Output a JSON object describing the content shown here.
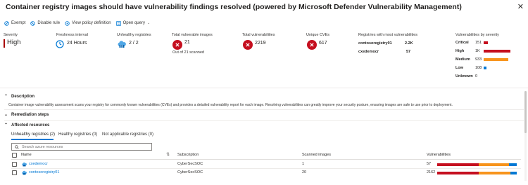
{
  "header": {
    "title": "Container registry images should have vulnerability findings resolved (powered by Microsoft Defender Vulnerability Management)",
    "close_icon": "close-icon"
  },
  "toolbar": {
    "exempt_label": "Exempt",
    "disable_rule_label": "Disable rule",
    "view_policy_label": "View policy definition",
    "open_query_label": "Open query"
  },
  "summary": {
    "severity": {
      "label": "Severity",
      "value": "High"
    },
    "freshness": {
      "label": "Freshness interval",
      "value": "24 Hours"
    },
    "unhealthy_registries": {
      "label": "Unhealthy registries",
      "value": "2 / 2"
    },
    "total_vulnerable_images": {
      "label": "Total vulnerable images",
      "value": "21",
      "sub": "Out of 21 scanned"
    },
    "total_vulnerabilities": {
      "label": "Total vulnerabilities",
      "value": "2219"
    },
    "unique_cves": {
      "label": "Unique CVEs",
      "value": "617"
    },
    "registries_most": {
      "label": "Registries with most vulnerabilities",
      "rows": [
        {
          "name": "contosoregistry01",
          "count": "2.2K"
        },
        {
          "name": "cxedemocr",
          "count": "57"
        }
      ]
    },
    "by_severity": {
      "label": "Vulnerabilities by severity",
      "rows": [
        {
          "label": "Critical",
          "count": "151",
          "fraction": 0.15,
          "color": "#c50f1f"
        },
        {
          "label": "High",
          "count": "1K",
          "fraction": 1.0,
          "color": "#c50f1f"
        },
        {
          "label": "Medium",
          "count": "933",
          "fraction": 0.93,
          "color": "#f7941d"
        },
        {
          "label": "Low",
          "count": "108",
          "fraction": 0.11,
          "color": "#0078d4"
        },
        {
          "label": "Unknown",
          "count": "0",
          "fraction": 0,
          "color": "#8a8886"
        }
      ]
    }
  },
  "sections": {
    "description": {
      "title": "Description",
      "text": "Container image vulnerability assessment scans your registry for commonly known vulnerabilities (CVEs) and provides a detailed vulnerability report for each image. Resolving vulnerabilities can greatly improve your security posture, ensuring images are safe to use prior to deployment."
    },
    "remediation": {
      "title": "Remediation steps"
    },
    "affected": {
      "title": "Affected resources"
    }
  },
  "tabs": [
    {
      "label": "Unhealthy registries (2)"
    },
    {
      "label": "Healthy registries (0)"
    },
    {
      "label": "Not applicable registries (0)"
    }
  ],
  "search": {
    "placeholder": "Search azure resources"
  },
  "table": {
    "columns": {
      "name": "Name",
      "subscription": "Subscription",
      "scanned_images": "Scanned images",
      "vulnerabilities": "Vulnerabilities"
    },
    "rows": [
      {
        "name": "cxedemocr",
        "subscription": "CyberSecSOC",
        "scanned": "1",
        "vulns": "57",
        "segments": [
          {
            "fraction": 0.52,
            "color": "#c50f1f"
          },
          {
            "fraction": 0.38,
            "color": "#f7941d"
          },
          {
            "fraction": 0.1,
            "color": "#0078d4"
          }
        ]
      },
      {
        "name": "contosoregistry01",
        "subscription": "CyberSecSOC",
        "scanned": "20",
        "vulns": "2162",
        "segments": [
          {
            "fraction": 0.52,
            "color": "#c50f1f"
          },
          {
            "fraction": 0.4,
            "color": "#f7941d"
          },
          {
            "fraction": 0.08,
            "color": "#0078d4"
          }
        ]
      }
    ]
  }
}
